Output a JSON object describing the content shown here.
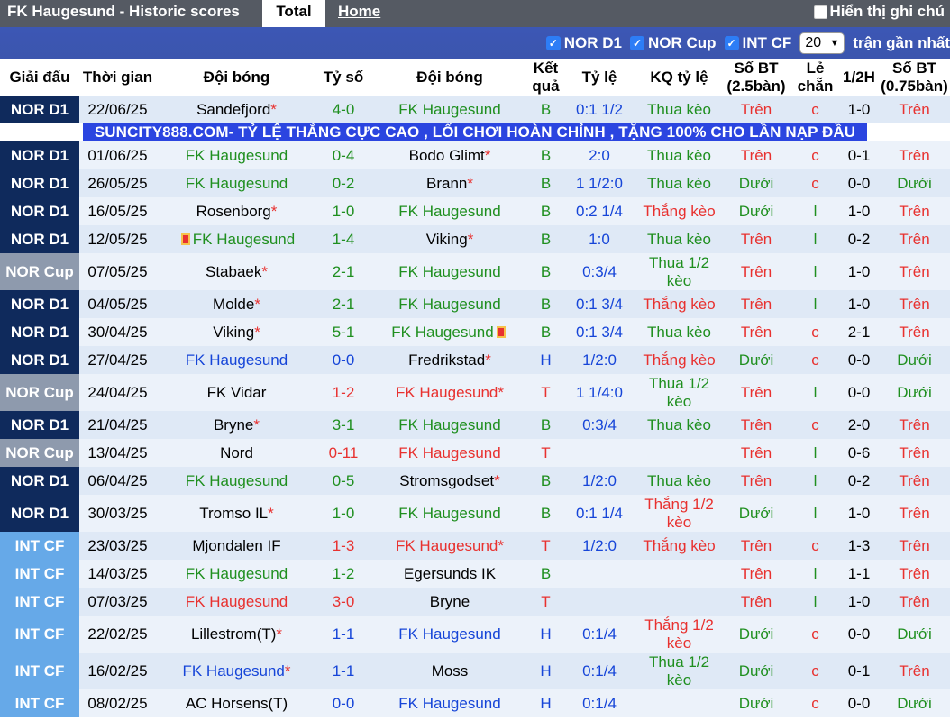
{
  "header": {
    "title": "FK Haugesund - Historic scores",
    "tabs": [
      "Total",
      "Home"
    ],
    "hint_label": "Hiển thị ghi chú"
  },
  "filters": {
    "items": [
      "NOR D1",
      "NOR Cup",
      "INT CF"
    ],
    "count_value": "20",
    "recent_label": "trận gần nhất"
  },
  "columns": [
    "Giải đấu",
    "Thời gian",
    "Đội bóng",
    "Tỷ số",
    "Đội bóng",
    "Kết quả",
    "Tỷ lệ",
    "KQ tỷ lệ",
    "Số BT (2.5bàn)",
    "Lẻ chẵn",
    "1/2H",
    "Số BT (0.75bàn)"
  ],
  "ad_text": "SUNCITY888.COM- TỶ LỆ THẮNG CỰC CAO , LỐI CHƠI HOÀN CHỈNH , TẶNG 100% CHO LẦN NẠP ĐẦU",
  "colors": {
    "win": "#e8312f",
    "draw": "#1645d8",
    "loss": "#1f8f1f",
    "league_d1": "#0f2a5c",
    "league_cup": "#8e9aad",
    "league_int": "#66a9e8"
  },
  "rows": [
    {
      "league": "NOR D1",
      "date": "22/06/25",
      "home": "Sandefjord",
      "home_star": "*",
      "home_card": "",
      "score": "4-0",
      "away": "FK Haugesund",
      "away_star": "",
      "away_card": "",
      "result": "B",
      "odds": "0:1 1/2",
      "odds_result": "Thua kèo",
      "ou": "Trên",
      "oe": "c",
      "ht": "1-0",
      "ou075": "Trên"
    },
    {
      "league": "NOR D1",
      "date": "01/06/25",
      "home": "FK Haugesund",
      "home_star": "",
      "home_card": "",
      "score": "0-4",
      "away": "Bodo Glimt",
      "away_star": "*",
      "away_card": "",
      "result": "B",
      "odds": "2:0",
      "odds_result": "Thua kèo",
      "ou": "Trên",
      "oe": "c",
      "ht": "0-1",
      "ou075": "Trên"
    },
    {
      "league": "NOR D1",
      "date": "26/05/25",
      "home": "FK Haugesund",
      "home_star": "",
      "home_card": "",
      "score": "0-2",
      "away": "Brann",
      "away_star": "*",
      "away_card": "",
      "result": "B",
      "odds": "1 1/2:0",
      "odds_result": "Thua kèo",
      "ou": "Dưới",
      "oe": "c",
      "ht": "0-0",
      "ou075": "Dưới"
    },
    {
      "league": "NOR D1",
      "date": "16/05/25",
      "home": "Rosenborg",
      "home_star": "*",
      "home_card": "",
      "score": "1-0",
      "away": "FK Haugesund",
      "away_star": "",
      "away_card": "",
      "result": "B",
      "odds": "0:2 1/4",
      "odds_result": "Thắng kèo",
      "ou": "Dưới",
      "oe": "l",
      "ht": "1-0",
      "ou075": "Trên"
    },
    {
      "league": "NOR D1",
      "date": "12/05/25",
      "home": "FK Haugesund",
      "home_star": "",
      "home_card": "1",
      "score": "1-4",
      "away": "Viking",
      "away_star": "*",
      "away_card": "",
      "result": "B",
      "odds": "1:0",
      "odds_result": "Thua kèo",
      "ou": "Trên",
      "oe": "l",
      "ht": "0-2",
      "ou075": "Trên"
    },
    {
      "league": "NOR Cup",
      "date": "07/05/25",
      "home": "Stabaek",
      "home_star": "*",
      "home_card": "",
      "score": "2-1",
      "away": "FK Haugesund",
      "away_star": "",
      "away_card": "",
      "result": "B",
      "odds": "0:3/4",
      "odds_result": "Thua 1/2 kèo",
      "ou": "Trên",
      "oe": "l",
      "ht": "1-0",
      "ou075": "Trên"
    },
    {
      "league": "NOR D1",
      "date": "04/05/25",
      "home": "Molde",
      "home_star": "*",
      "home_card": "",
      "score": "2-1",
      "away": "FK Haugesund",
      "away_star": "",
      "away_card": "",
      "result": "B",
      "odds": "0:1 3/4",
      "odds_result": "Thắng kèo",
      "ou": "Trên",
      "oe": "l",
      "ht": "1-0",
      "ou075": "Trên"
    },
    {
      "league": "NOR D1",
      "date": "30/04/25",
      "home": "Viking",
      "home_star": "*",
      "home_card": "",
      "score": "5-1",
      "away": "FK Haugesund",
      "away_star": "",
      "away_card": "1",
      "result": "B",
      "odds": "0:1 3/4",
      "odds_result": "Thua kèo",
      "ou": "Trên",
      "oe": "c",
      "ht": "2-1",
      "ou075": "Trên"
    },
    {
      "league": "NOR D1",
      "date": "27/04/25",
      "home": "FK Haugesund",
      "home_star": "",
      "home_card": "",
      "score": "0-0",
      "away": "Fredrikstad",
      "away_star": "*",
      "away_card": "",
      "result": "H",
      "odds": "1/2:0",
      "odds_result": "Thắng kèo",
      "ou": "Dưới",
      "oe": "c",
      "ht": "0-0",
      "ou075": "Dưới"
    },
    {
      "league": "NOR Cup",
      "date": "24/04/25",
      "home": "FK Vidar",
      "home_star": "",
      "home_card": "",
      "score": "1-2",
      "away": "FK Haugesund",
      "away_star": "*",
      "away_card": "",
      "result": "T",
      "odds": "1 1/4:0",
      "odds_result": "Thua 1/2 kèo",
      "ou": "Trên",
      "oe": "l",
      "ht": "0-0",
      "ou075": "Dưới"
    },
    {
      "league": "NOR D1",
      "date": "21/04/25",
      "home": "Bryne",
      "home_star": "*",
      "home_card": "",
      "score": "3-1",
      "away": "FK Haugesund",
      "away_star": "",
      "away_card": "",
      "result": "B",
      "odds": "0:3/4",
      "odds_result": "Thua kèo",
      "ou": "Trên",
      "oe": "c",
      "ht": "2-0",
      "ou075": "Trên"
    },
    {
      "league": "NOR Cup",
      "date": "13/04/25",
      "home": "Nord",
      "home_star": "",
      "home_card": "",
      "score": "0-11",
      "away": "FK Haugesund",
      "away_star": "",
      "away_card": "",
      "result": "T",
      "odds": "",
      "odds_result": "",
      "ou": "Trên",
      "oe": "l",
      "ht": "0-6",
      "ou075": "Trên"
    },
    {
      "league": "NOR D1",
      "date": "06/04/25",
      "home": "FK Haugesund",
      "home_star": "",
      "home_card": "",
      "score": "0-5",
      "away": "Stromsgodset",
      "away_star": "*",
      "away_card": "",
      "result": "B",
      "odds": "1/2:0",
      "odds_result": "Thua kèo",
      "ou": "Trên",
      "oe": "l",
      "ht": "0-2",
      "ou075": "Trên"
    },
    {
      "league": "NOR D1",
      "date": "30/03/25",
      "home": "Tromso IL",
      "home_star": "*",
      "home_card": "",
      "score": "1-0",
      "away": "FK Haugesund",
      "away_star": "",
      "away_card": "",
      "result": "B",
      "odds": "0:1 1/4",
      "odds_result": "Thắng 1/2 kèo",
      "ou": "Dưới",
      "oe": "l",
      "ht": "1-0",
      "ou075": "Trên"
    },
    {
      "league": "INT CF",
      "date": "23/03/25",
      "home": "Mjondalen IF",
      "home_star": "",
      "home_card": "",
      "score": "1-3",
      "away": "FK Haugesund",
      "away_star": "*",
      "away_card": "",
      "result": "T",
      "odds": "1/2:0",
      "odds_result": "Thắng kèo",
      "ou": "Trên",
      "oe": "c",
      "ht": "1-3",
      "ou075": "Trên"
    },
    {
      "league": "INT CF",
      "date": "14/03/25",
      "home": "FK Haugesund",
      "home_star": "",
      "home_card": "",
      "score": "1-2",
      "away": "Egersunds IK",
      "away_star": "",
      "away_card": "",
      "result": "B",
      "odds": "",
      "odds_result": "",
      "ou": "Trên",
      "oe": "l",
      "ht": "1-1",
      "ou075": "Trên"
    },
    {
      "league": "INT CF",
      "date": "07/03/25",
      "home": "FK Haugesund",
      "home_star": "",
      "home_card": "",
      "score": "3-0",
      "away": "Bryne",
      "away_star": "",
      "away_card": "",
      "result": "T",
      "odds": "",
      "odds_result": "",
      "ou": "Trên",
      "oe": "l",
      "ht": "1-0",
      "ou075": "Trên"
    },
    {
      "league": "INT CF",
      "date": "22/02/25",
      "home": "Lillestrom(T)",
      "home_star": "*",
      "home_card": "",
      "score": "1-1",
      "away": "FK Haugesund",
      "away_star": "",
      "away_card": "",
      "result": "H",
      "odds": "0:1/4",
      "odds_result": "Thắng 1/2 kèo",
      "ou": "Dưới",
      "oe": "c",
      "ht": "0-0",
      "ou075": "Dưới"
    },
    {
      "league": "INT CF",
      "date": "16/02/25",
      "home": "FK Haugesund",
      "home_star": "*",
      "home_card": "",
      "score": "1-1",
      "away": "Moss",
      "away_star": "",
      "away_card": "",
      "result": "H",
      "odds": "0:1/4",
      "odds_result": "Thua 1/2 kèo",
      "ou": "Dưới",
      "oe": "c",
      "ht": "0-1",
      "ou075": "Trên"
    },
    {
      "league": "INT CF",
      "date": "08/02/25",
      "home": "AC Horsens(T)",
      "home_star": "",
      "home_card": "",
      "score": "0-0",
      "away": "FK Haugesund",
      "away_star": "",
      "away_card": "",
      "result": "H",
      "odds": "0:1/4",
      "odds_result": "",
      "ou": "Dưới",
      "oe": "c",
      "ht": "0-0",
      "ou075": "Dưới"
    }
  ]
}
